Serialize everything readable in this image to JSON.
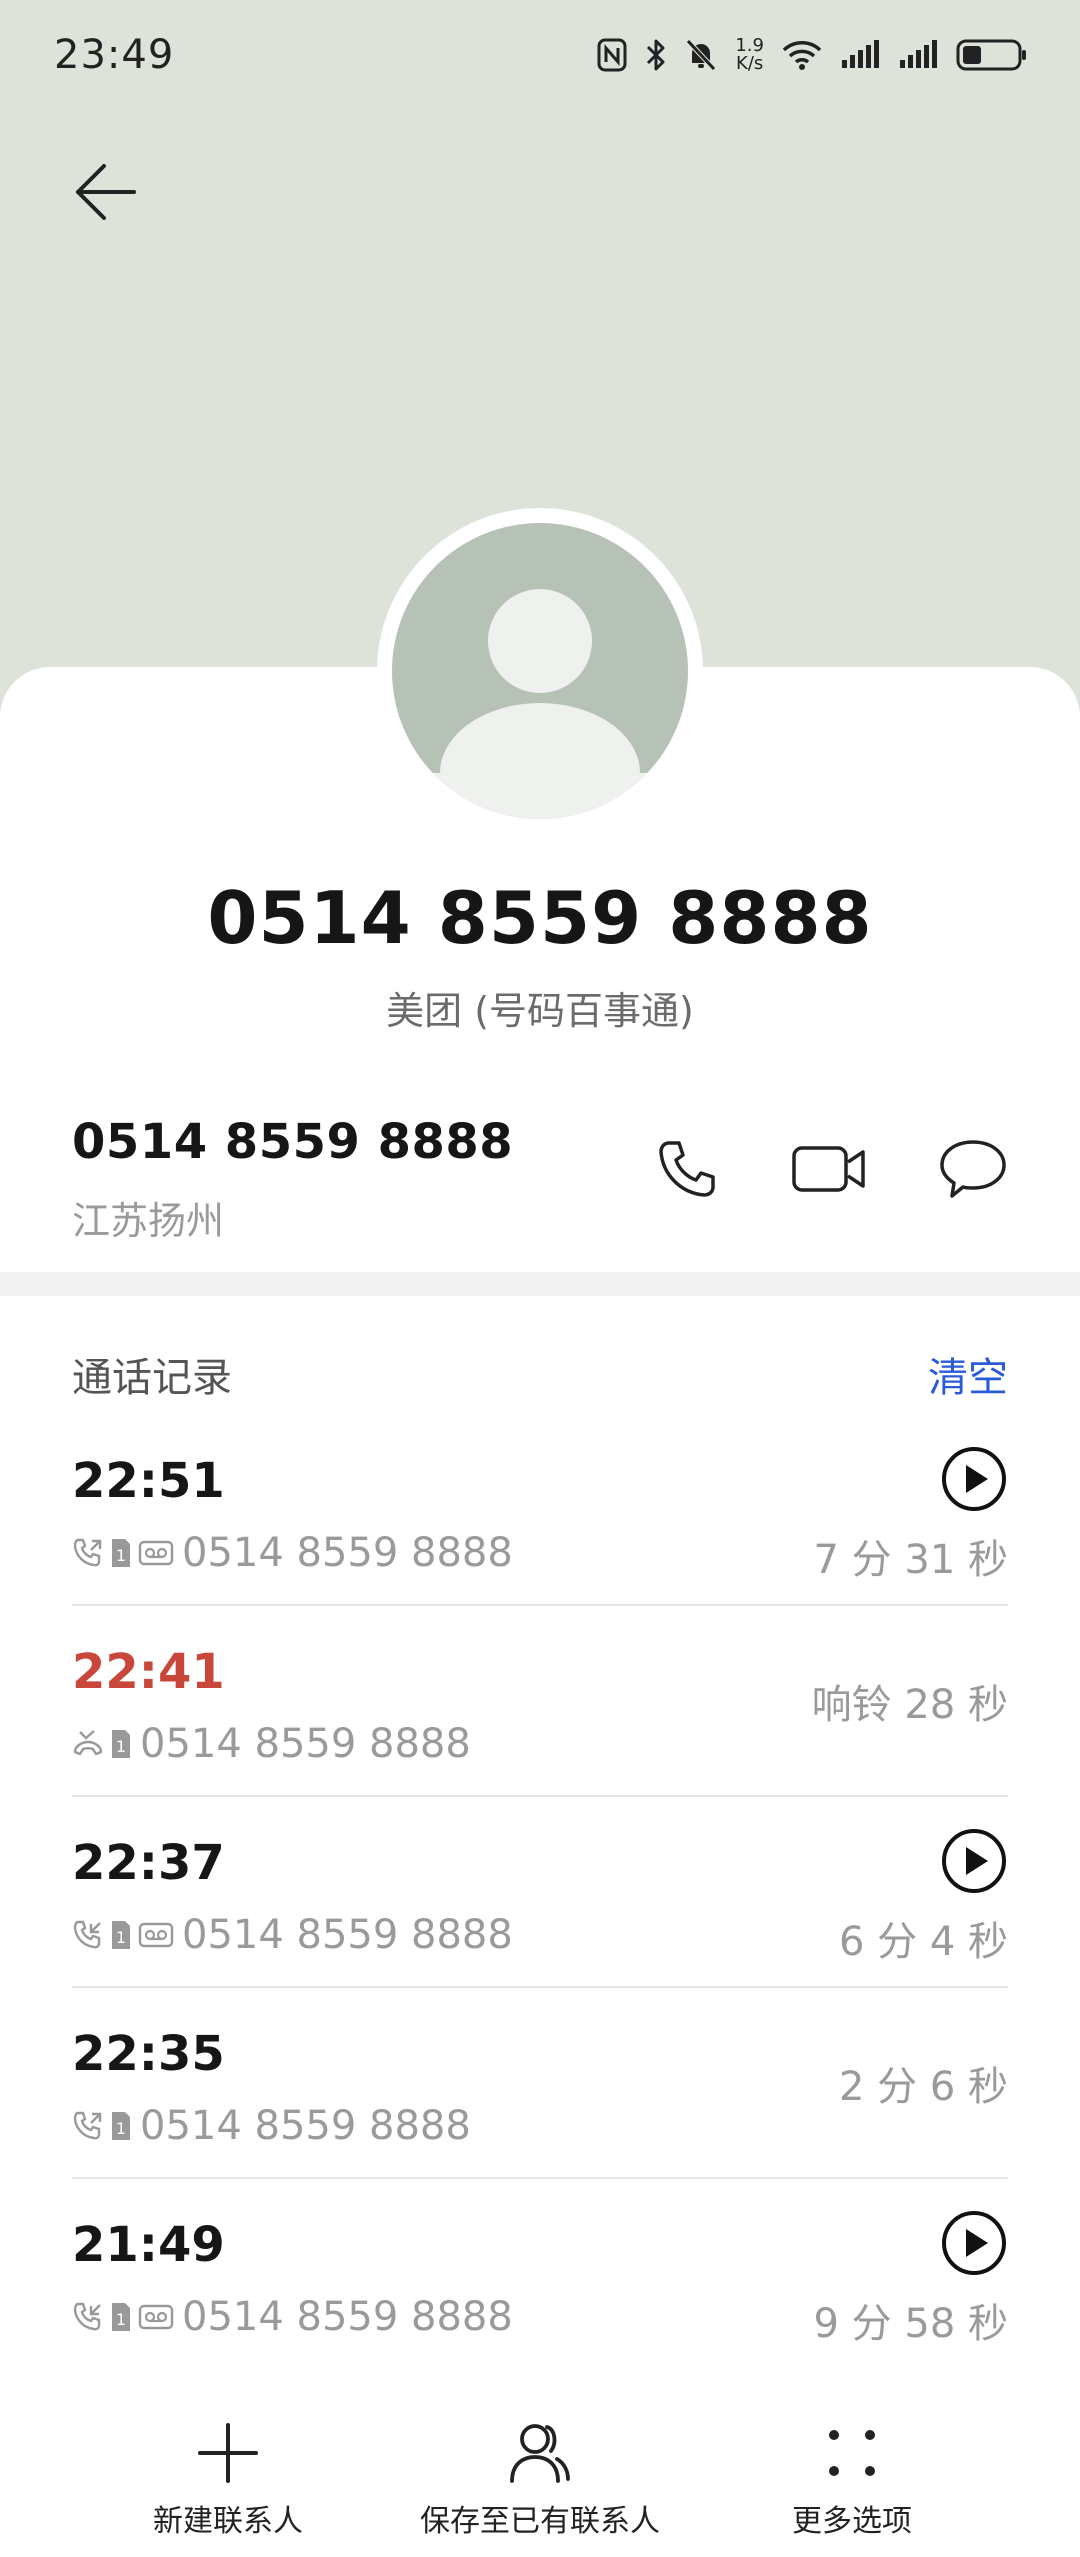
{
  "status_bar": {
    "time": "23:49",
    "net_speed_value": "1.9",
    "net_speed_unit": "K/s",
    "icons": [
      "nfc-icon",
      "bluetooth-icon",
      "mute-icon",
      "wifi-icon",
      "signal-icon",
      "signal-icon",
      "battery-icon"
    ]
  },
  "header": {
    "back_icon": "arrow-left-icon"
  },
  "contact": {
    "name": "0514 8559 8888",
    "subtitle": "美团 (号码百事通)",
    "number": "0514 8559 8888",
    "location": "江苏扬州",
    "actions": [
      "phone-icon",
      "video-call-icon",
      "message-icon"
    ]
  },
  "call_log": {
    "title": "通话记录",
    "clear_label": "清空",
    "entries": [
      {
        "time": "22:51",
        "number": "0514 8559 8888",
        "duration": "7 分 31 秒",
        "type": "outgoing",
        "sim": "1",
        "recorded": true,
        "missed": false
      },
      {
        "time": "22:41",
        "number": "0514 8559 8888",
        "duration": "响铃 28 秒",
        "type": "missed",
        "sim": "1",
        "recorded": false,
        "missed": true
      },
      {
        "time": "22:37",
        "number": "0514 8559 8888",
        "duration": "6 分 4 秒",
        "type": "incoming",
        "sim": "1",
        "recorded": true,
        "missed": false
      },
      {
        "time": "22:35",
        "number": "0514 8559 8888",
        "duration": "2 分 6 秒",
        "type": "outgoing",
        "sim": "1",
        "recorded": false,
        "missed": false
      },
      {
        "time": "21:49",
        "number": "0514 8559 8888",
        "duration": "9 分 58 秒",
        "type": "incoming",
        "sim": "1",
        "recorded": true,
        "missed": false
      }
    ]
  },
  "bottom_bar": {
    "new_contact": "新建联系人",
    "save_existing": "保存至已有联系人",
    "more_options": "更多选项"
  },
  "colors": {
    "header_bg": "#dde3d9",
    "avatar_bg": "#b7c2b6",
    "missed": "#c8463a",
    "accent": "#2a5bd7"
  }
}
